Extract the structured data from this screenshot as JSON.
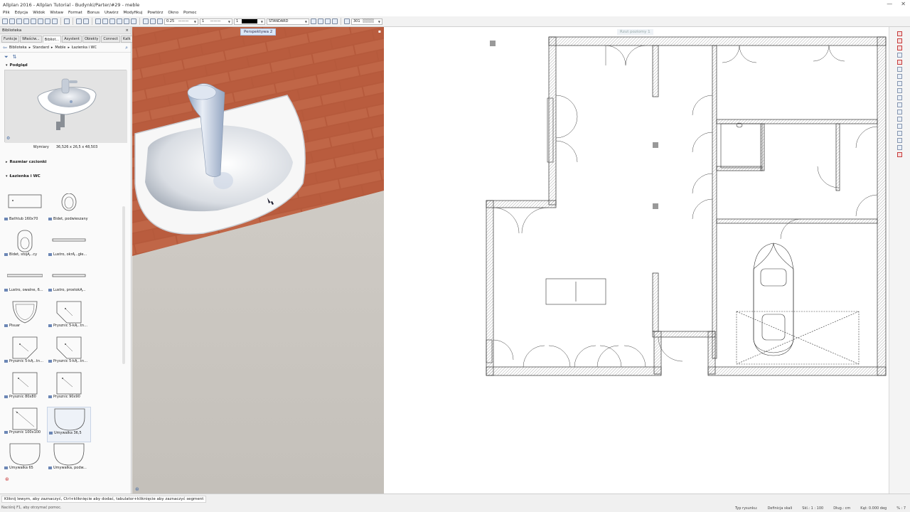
{
  "window": {
    "title": "Allplan 2016 - Allplan Tutorial - Budynki/Parter/#29 - meble",
    "minimize": "—",
    "close": "✕"
  },
  "menu": [
    "Plik",
    "Edycja",
    "Widok",
    "Wstaw",
    "Format",
    "Bonus",
    "Utwórz",
    "Modyfikuj",
    "Powtórz",
    "Okno",
    "Pomoc"
  ],
  "toolbar": {
    "pen": "0.25",
    "line": "1",
    "color": "1",
    "layer": "STANDARD",
    "scale": "301"
  },
  "sidebar": {
    "title": "Biblioteka",
    "close": "×",
    "tabs": [
      "Funkcje",
      "Właściw...",
      "Bibliot...",
      "Asystent",
      "Obiekty",
      "Connect",
      "Kalk"
    ],
    "breadcrumb": [
      "Biblioteka",
      "Standard",
      "Meble",
      "Łazienka i WC"
    ],
    "preview_heading": "Podgląd",
    "dims_label": "Wymiary",
    "dims_value": "36,526 x 26,5 x 48,503",
    "font_size_heading": "Rozmiar czcionki",
    "category_heading": "Łazienka i WC",
    "items": [
      [
        "Bathtub 160x70",
        "Bidet, podwieszany"
      ],
      [
        "Bidet, stojĄ...cy",
        "Lustro, okrĄ...głe..."
      ],
      [
        "Lustro, owalne, 6...",
        "Lustro, prostokĄ..."
      ],
      [
        "Pisuar",
        "Prysznic 5-kĄ...tn..."
      ],
      [
        "Prysznic 5-kĄ...tn...",
        "Prysznic 5-kĄ...tn..."
      ],
      [
        "Prysznic 80x80",
        "Prysznic 90x90"
      ],
      [
        "Prysznic 100x100",
        "Umywalka 36,5"
      ],
      [
        "Umywalka 65",
        "Umywalka, podw..."
      ]
    ]
  },
  "view3d": {
    "tag": "Perspektywa 2"
  },
  "plan": {
    "tag": "Rzut poziomy 1"
  },
  "status": {
    "message": "Kliknij lewym, aby zaznaczyć, Ctrl+kliknięcie aby dodać, tabulator+kliknięcie aby zaznaczyć segment",
    "hint": "Naciśnij F1, aby otrzymać pomoc.",
    "draw_type_label": "Typ rysunku:",
    "draw_type_value": "Definicja skali",
    "scale_label": "Skl.: 1 : 100",
    "length": "Dług.:  cm",
    "angle": "Kąt:  0.000   deg",
    "percent": "% :  7"
  }
}
